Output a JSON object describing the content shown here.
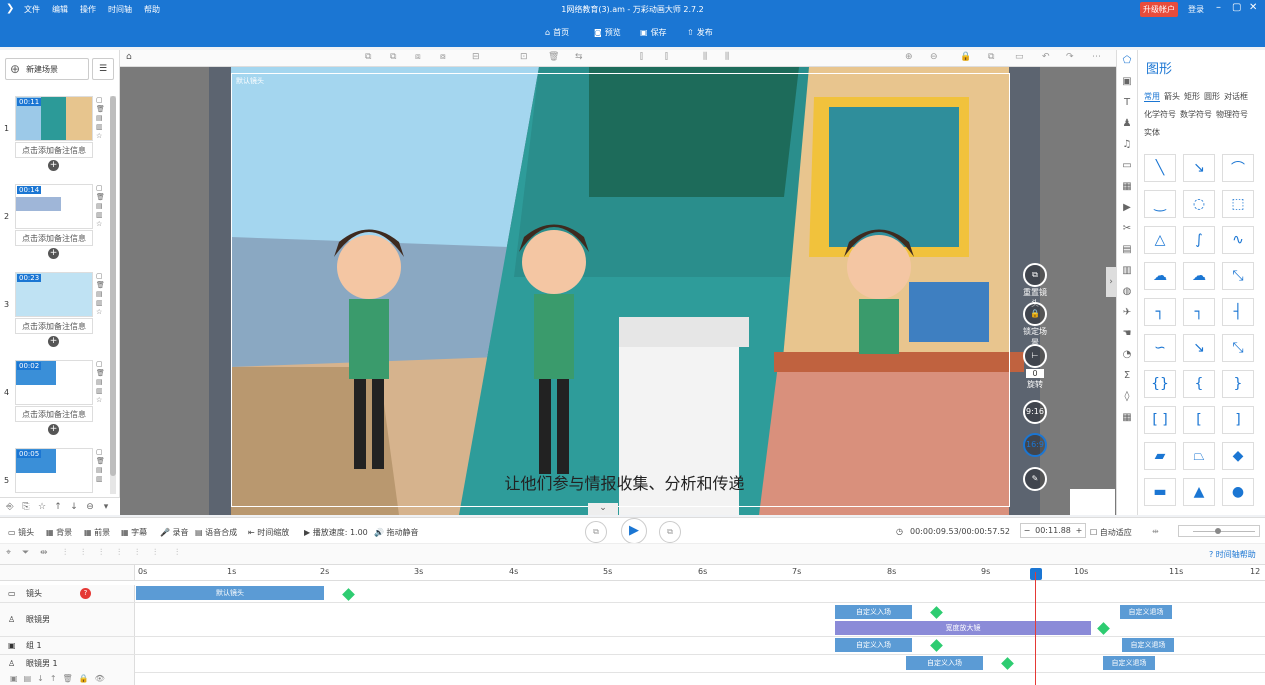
{
  "app": {
    "title": "1网络教育(3).am - 万彩动画大师 2.7.2",
    "menu": [
      "文件",
      "编辑",
      "操作",
      "时间轴",
      "帮助"
    ],
    "upgrade": "升级帐户",
    "login": "登录"
  },
  "toolbar": {
    "items": [
      "首页",
      "预览",
      "保存",
      "发布"
    ]
  },
  "left": {
    "new_scene": "新建场景",
    "scenes": [
      {
        "num": "1",
        "time": "00:11",
        "note": "点击添加备注信息"
      },
      {
        "num": "2",
        "time": "00:14",
        "note": "点击添加备注信息"
      },
      {
        "num": "3",
        "time": "00:23",
        "note": "点击添加备注信息"
      },
      {
        "num": "4",
        "time": "00:02",
        "note": "点击添加备注信息"
      },
      {
        "num": "5",
        "time": "00:05",
        "note": ""
      }
    ]
  },
  "canvas": {
    "subtitle": "让他们参与情报收集、分析和传递",
    "camera_label": "默认镜头",
    "controls": {
      "reset": "重置镜头",
      "lock": "锁定场景",
      "rotate": "旋转",
      "rotate_val": "0",
      "r916": "9:16",
      "r169": "16:9"
    }
  },
  "right": {
    "title": "图形",
    "cats": [
      "常用",
      "箭头",
      "矩形",
      "圆形",
      "对话框",
      "化学符号",
      "数学符号",
      "物理符号",
      "实体"
    ]
  },
  "timeline": {
    "bar": [
      "镜头",
      "背景",
      "前景",
      "字幕",
      "录音",
      "语音合成",
      "时间缩放",
      "播放速度: 1.00",
      "拖动静音"
    ],
    "time": "00:00:09.53/00:00:57.52",
    "cur": "00:11.88",
    "auto_fit": "自动适应",
    "help": "时间轴帮助",
    "ticks": [
      "0s",
      "1s",
      "2s",
      "3s",
      "4s",
      "5s",
      "6s",
      "7s",
      "8s",
      "9s",
      "10s",
      "11s",
      "12"
    ],
    "tracks": [
      {
        "name": "镜头",
        "bars": [
          {
            "t": "默认镜头",
            "c": "#5b9bd5"
          }
        ]
      },
      {
        "name": "眼镜男",
        "bars": [
          {
            "t": "自定义入场",
            "c": "#5b9bd5"
          },
          {
            "t": "自定义退场",
            "c": "#5b9bd5"
          }
        ]
      },
      {
        "name": "",
        "bars": [
          {
            "t": "宽度放大镜",
            "c": "#8b8bd8"
          }
        ]
      },
      {
        "name": "组 1",
        "bars": [
          {
            "t": "自定义入场",
            "c": "#5b9bd5"
          },
          {
            "t": "自定义退场",
            "c": "#5b9bd5"
          }
        ]
      },
      {
        "name": "眼镜男 1",
        "bars": [
          {
            "t": "自定义入场",
            "c": "#5b9bd5"
          },
          {
            "t": "自定义退场",
            "c": "#5b9bd5"
          }
        ]
      }
    ]
  }
}
